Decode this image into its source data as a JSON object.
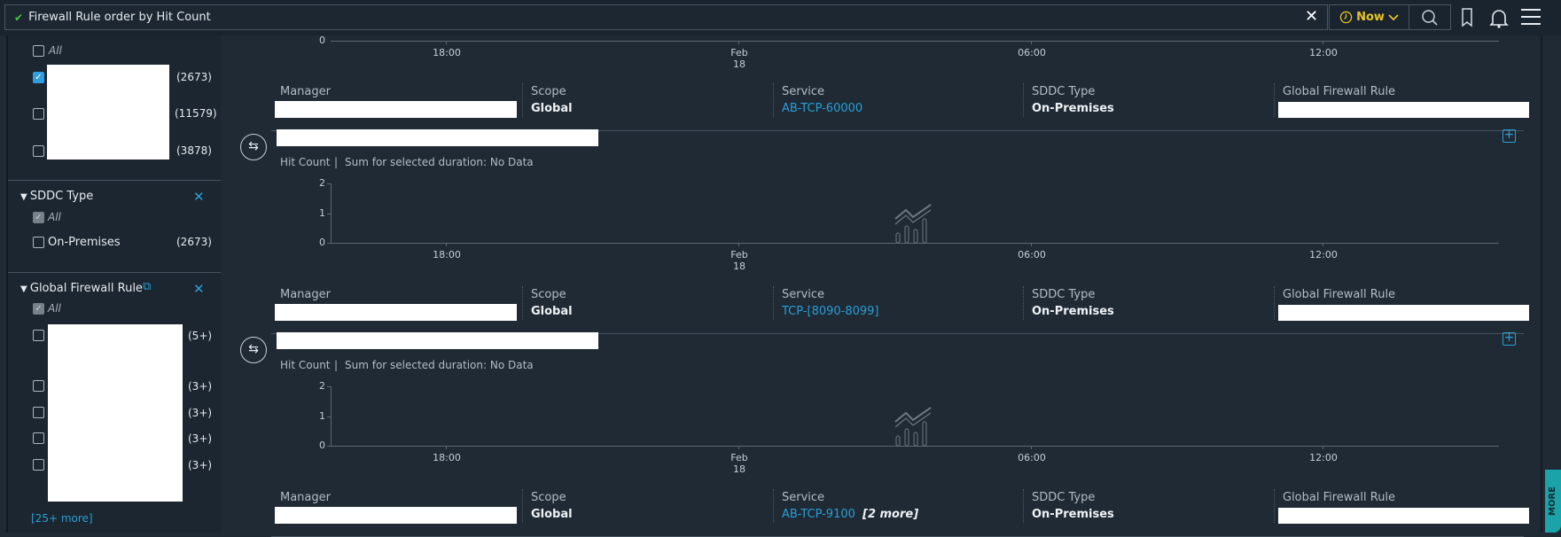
{
  "topbar": {
    "query": "Firewall Rule order by  Hit Count",
    "time": "Now"
  },
  "sidebar": {
    "group1": {
      "all": "All",
      "items": [
        {
          "count": "(2673)",
          "checked": true
        },
        {
          "count": "(11579)"
        },
        {
          "count": "(3878)"
        }
      ]
    },
    "sddc": {
      "title": "SDDC Type",
      "all": "All",
      "items": [
        {
          "label": "On-Premises",
          "count": "(2673)"
        }
      ]
    },
    "gfr": {
      "title": "Global Firewall Rule",
      "all": "All",
      "items": [
        {
          "count": "(5+)"
        },
        {
          "count": "(3+)"
        },
        {
          "count": "(3+)"
        },
        {
          "count": "(3+)"
        },
        {
          "count": "(3+)"
        }
      ],
      "more": "[25+ more]"
    }
  },
  "chart_axis": {
    "y_ticks": [
      "2",
      "1",
      "0"
    ],
    "x_ticks": [
      "18:00",
      "Feb 18",
      "06:00",
      "12:00"
    ],
    "top_partial_y": "0"
  },
  "cards": [
    {
      "details": {
        "manager_label": "Manager",
        "scope_label": "Scope",
        "scope": "Global",
        "service_label": "Service",
        "service": "AB-TCP-60000",
        "service_more": "",
        "sddc_label": "SDDC Type",
        "sddc": "On-Premises",
        "gfr_label": "Global Firewall Rule"
      }
    },
    {
      "metric": "Hit Count",
      "sep": "|",
      "summary": "Sum for selected duration: No Data",
      "details": {
        "manager_label": "Manager",
        "scope_label": "Scope",
        "scope": "Global",
        "service_label": "Service",
        "service": "TCP-[8090-8099]",
        "service_more": "",
        "sddc_label": "SDDC Type",
        "sddc": "On-Premises",
        "gfr_label": "Global Firewall Rule"
      }
    },
    {
      "metric": "Hit Count",
      "sep": "|",
      "summary": "Sum for selected duration: No Data",
      "details": {
        "manager_label": "Manager",
        "scope_label": "Scope",
        "scope": "Global",
        "service_label": "Service",
        "service": "AB-TCP-9100",
        "service_more": "[2 more]",
        "sddc_label": "SDDC Type",
        "sddc": "On-Premises",
        "gfr_label": "Global Firewall Rule"
      }
    }
  ],
  "guides": "MORE GUIDES"
}
